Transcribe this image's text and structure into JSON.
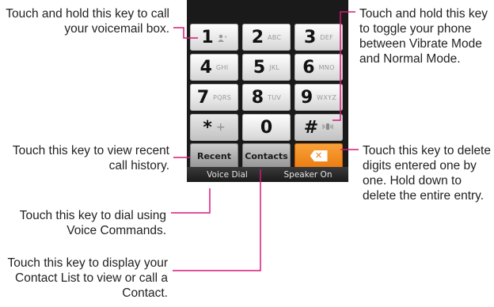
{
  "keypad": {
    "keys": [
      {
        "digit": "1",
        "letters": ""
      },
      {
        "digit": "2",
        "letters": "ABC"
      },
      {
        "digit": "3",
        "letters": "DEF"
      },
      {
        "digit": "4",
        "letters": "GHI"
      },
      {
        "digit": "5",
        "letters": "JKL"
      },
      {
        "digit": "6",
        "letters": "MNO"
      },
      {
        "digit": "7",
        "letters": "PQRS"
      },
      {
        "digit": "8",
        "letters": "TUV"
      },
      {
        "digit": "9",
        "letters": "WXYZ"
      },
      {
        "digit": "*",
        "letters": "+"
      },
      {
        "digit": "0",
        "letters": ""
      },
      {
        "digit": "#",
        "letters": ""
      }
    ],
    "recent_label": "Recent",
    "contacts_label": "Contacts",
    "delete_glyph": "✕"
  },
  "softkeys": {
    "voice_dial": "Voice Dial",
    "speaker_on": "Speaker On"
  },
  "callouts": {
    "voicemail": "Touch and hold this key to call your voicemail box.",
    "vibrate": "Touch and hold this key to toggle your phone between Vibrate Mode and Normal Mode.",
    "recent": "Touch this key to view recent call history.",
    "delete": "Touch this key to delete digits entered one by one. Hold down to delete the entire entry.",
    "voice_dial": "Touch this key to dial using Voice Commands.",
    "contacts": "Touch this key to display your Contact List to view or call a Contact."
  },
  "colors": {
    "leader_line": "#d6187a",
    "delete_key": "#ef8018"
  }
}
